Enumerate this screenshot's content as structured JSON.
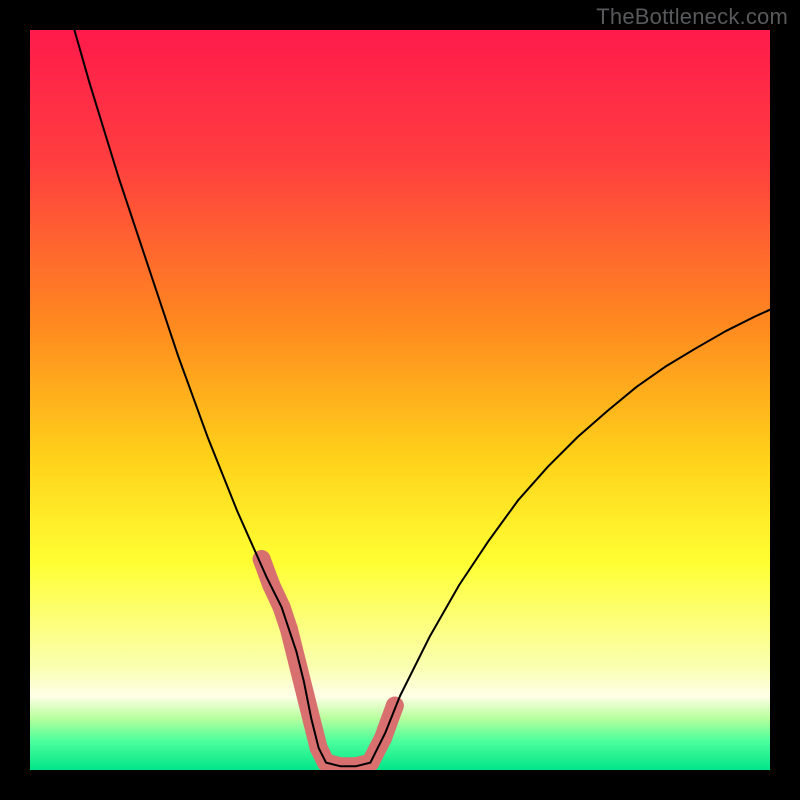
{
  "watermark": "TheBottleneck.com",
  "chart_data": {
    "type": "line",
    "title": "",
    "xlabel": "",
    "ylabel": "",
    "xlim": [
      0,
      100
    ],
    "ylim": [
      0,
      100
    ],
    "grid": false,
    "legend": false,
    "gradient_stops": [
      {
        "offset": 0.0,
        "color": "#ff1a4b"
      },
      {
        "offset": 0.18,
        "color": "#ff3f3f"
      },
      {
        "offset": 0.4,
        "color": "#ff8a1f"
      },
      {
        "offset": 0.58,
        "color": "#ffd21a"
      },
      {
        "offset": 0.72,
        "color": "#ffff33"
      },
      {
        "offset": 0.86,
        "color": "#faffb0"
      },
      {
        "offset": 0.9,
        "color": "#ffffe6"
      },
      {
        "offset": 0.93,
        "color": "#b8ff9e"
      },
      {
        "offset": 0.96,
        "color": "#4fff9c"
      },
      {
        "offset": 1.0,
        "color": "#00e58a"
      }
    ],
    "series": [
      {
        "name": "bottleneck-curve",
        "stroke": "#000000",
        "stroke_width": 2,
        "x": [
          6,
          8,
          10,
          12,
          14,
          16,
          18,
          20,
          22,
          24,
          26,
          28,
          30,
          32,
          33,
          34,
          35,
          36,
          37,
          38,
          39,
          40,
          42,
          44,
          46,
          48,
          50,
          54,
          58,
          62,
          66,
          70,
          74,
          78,
          82,
          86,
          90,
          94,
          98,
          100
        ],
        "y": [
          100,
          93,
          86.5,
          80,
          74,
          68,
          62,
          56,
          50.5,
          45,
          40,
          35,
          30.5,
          26,
          24,
          22,
          19,
          16,
          12,
          7,
          3,
          1,
          0.5,
          0.5,
          1,
          5,
          10,
          18,
          25,
          31,
          36.5,
          41,
          45,
          48.5,
          51.8,
          54.6,
          57,
          59.3,
          61.3,
          62.2
        ]
      },
      {
        "name": "highlight-markers",
        "stroke": "#d87070",
        "marker_radius": 9,
        "x": [
          31.3,
          32.6,
          34.0,
          35.0,
          39.0,
          40.0,
          42.0,
          44.0,
          46.0,
          47.7,
          49.3
        ],
        "y": [
          28.5,
          25.0,
          22.0,
          19.0,
          3.0,
          1.0,
          0.5,
          0.5,
          1.0,
          4.3,
          8.7
        ]
      }
    ]
  }
}
